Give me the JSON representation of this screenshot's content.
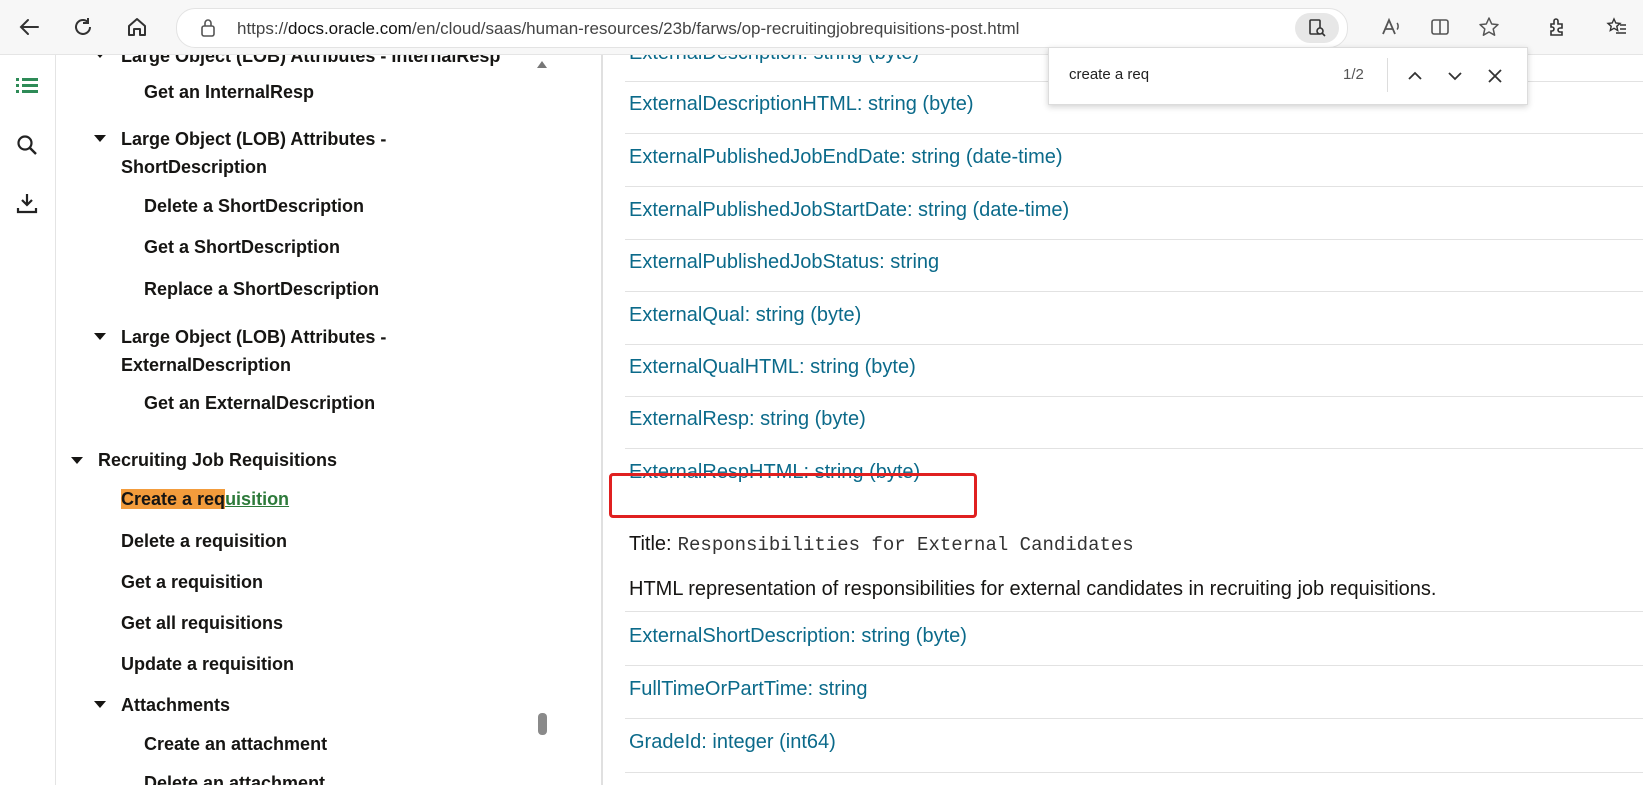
{
  "browser": {
    "url_prefix": "https://",
    "url_host": "docs.oracle.com",
    "url_path": "/en/cloud/saas/human-resources/23b/farws/op-recruitingjobrequisitions-post.html"
  },
  "find": {
    "query": "create a req",
    "count": "1/2"
  },
  "nav": {
    "items": [
      {
        "label": "Large Object (LOB) Attributes - InternalResp"
      },
      {
        "label": "Get an InternalResp"
      },
      {
        "label": "Large Object (LOB) Attributes -"
      },
      {
        "label": "ShortDescription"
      },
      {
        "label": "Delete a ShortDescription"
      },
      {
        "label": "Get a ShortDescription"
      },
      {
        "label": "Replace a ShortDescription"
      },
      {
        "label": "Large Object (LOB) Attributes -"
      },
      {
        "label": "ExternalDescription"
      },
      {
        "label": "Get an ExternalDescription"
      },
      {
        "label": "Recruiting Job Requisitions"
      },
      {
        "label": "Create a req",
        "label_rest": "uisition"
      },
      {
        "label": "Delete a requisition"
      },
      {
        "label": "Get a requisition"
      },
      {
        "label": "Get all requisitions"
      },
      {
        "label": "Update a requisition"
      },
      {
        "label": "Attachments"
      },
      {
        "label": "Create an attachment"
      },
      {
        "label": "Delete an attachment"
      }
    ]
  },
  "main": {
    "attributes": [
      "ExternalDescription: string (byte)",
      "ExternalDescriptionHTML: string (byte)",
      "ExternalPublishedJobEndDate: string (date-time)",
      "ExternalPublishedJobStartDate: string (date-time)",
      "ExternalPublishedJobStatus: string",
      "ExternalQual: string (byte)",
      "ExternalQualHTML: string (byte)",
      "ExternalResp: string (byte)",
      "ExternalRespHTML: string (byte)",
      "ExternalShortDescription: string (byte)",
      "FullTimeOrPartTime: string",
      "GradeId: integer (int64)"
    ],
    "title_label": "Title:",
    "title_value": "Responsibilities for External Candidates",
    "description": "HTML representation of responsibilities for external candidates in recruiting job requisitions."
  },
  "colors": {
    "link": "#0b6a8a",
    "highlight": "#f39c3c",
    "red_box": "#e02020"
  }
}
